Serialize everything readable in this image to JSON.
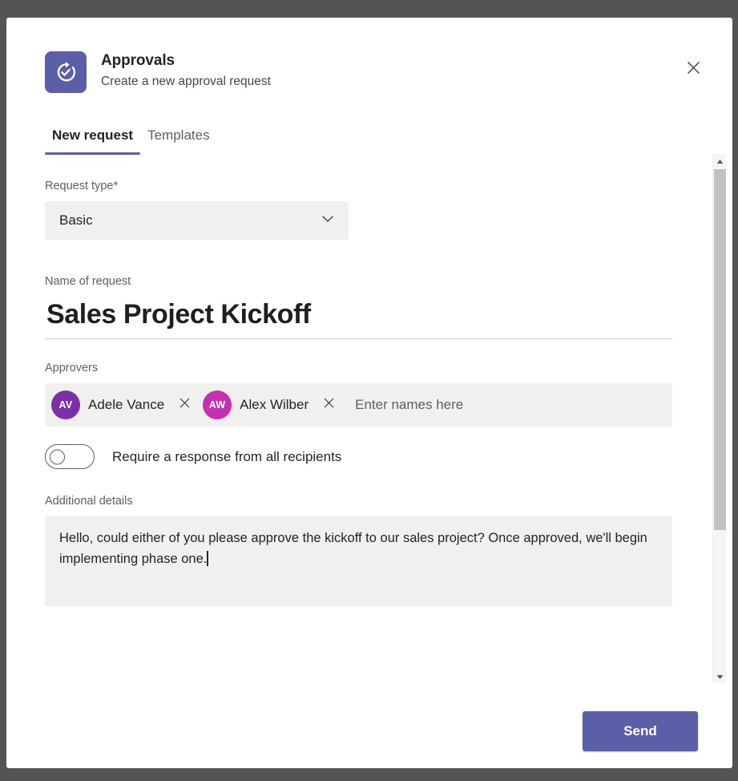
{
  "dialog": {
    "app_title": "Approvals",
    "app_subtitle": "Create a new approval request",
    "app_icon": "approvals-refresh-check-icon",
    "close_icon": "close-icon",
    "accent_color": "#5b5fa8"
  },
  "tabs": [
    {
      "label": "New request",
      "active": true
    },
    {
      "label": "Templates",
      "active": false
    }
  ],
  "form": {
    "request_type": {
      "label": "Request type*",
      "value": "Basic",
      "chevron_icon": "chevron-down-icon",
      "options": [
        "Basic"
      ]
    },
    "name_of_request": {
      "label": "Name of request",
      "value": "Sales Project Kickoff"
    },
    "approvers": {
      "label": "Approvers",
      "placeholder": "Enter names here",
      "input_value": "",
      "chips": [
        {
          "name": "Adele Vance",
          "initials": "AV",
          "avatar_color": "#7b2fa8",
          "remove_icon": "close-icon"
        },
        {
          "name": "Alex Wilber",
          "initials": "AW",
          "avatar_color": "#c72fb3",
          "remove_icon": "close-icon"
        }
      ]
    },
    "require_response": {
      "label": "Require a response from all recipients",
      "state": "off"
    },
    "additional_details": {
      "label": "Additional details",
      "value": "Hello, could either of you please approve the kickoff to our sales project? Once approved, we'll begin implementing phase one."
    }
  },
  "actions": {
    "send_label": "Send"
  },
  "scrollbar": {
    "up_icon": "triangle-up-icon",
    "down_icon": "triangle-down-icon"
  }
}
